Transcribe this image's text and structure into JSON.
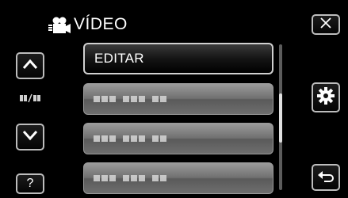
{
  "header": {
    "title": "VÍDEO",
    "mode_icon": "video-camera-icon"
  },
  "nav": {
    "close_icon": "close-icon",
    "up_icon": "chevron-up-icon",
    "down_icon": "chevron-down-icon",
    "help_label": "?",
    "settings_icon": "gear-icon",
    "back_icon": "return-arrow-icon",
    "page_indicator_icon": "page-indicator-icon"
  },
  "menu": {
    "items": [
      {
        "label": "EDITAR",
        "selected": true
      },
      {
        "label": "",
        "selected": false
      },
      {
        "label": "",
        "selected": false
      },
      {
        "label": "",
        "selected": false
      }
    ]
  },
  "scroll": {
    "position": 0.35
  },
  "colors": {
    "background": "#000000",
    "frame": "#bdbdbd",
    "item": "#777777"
  }
}
